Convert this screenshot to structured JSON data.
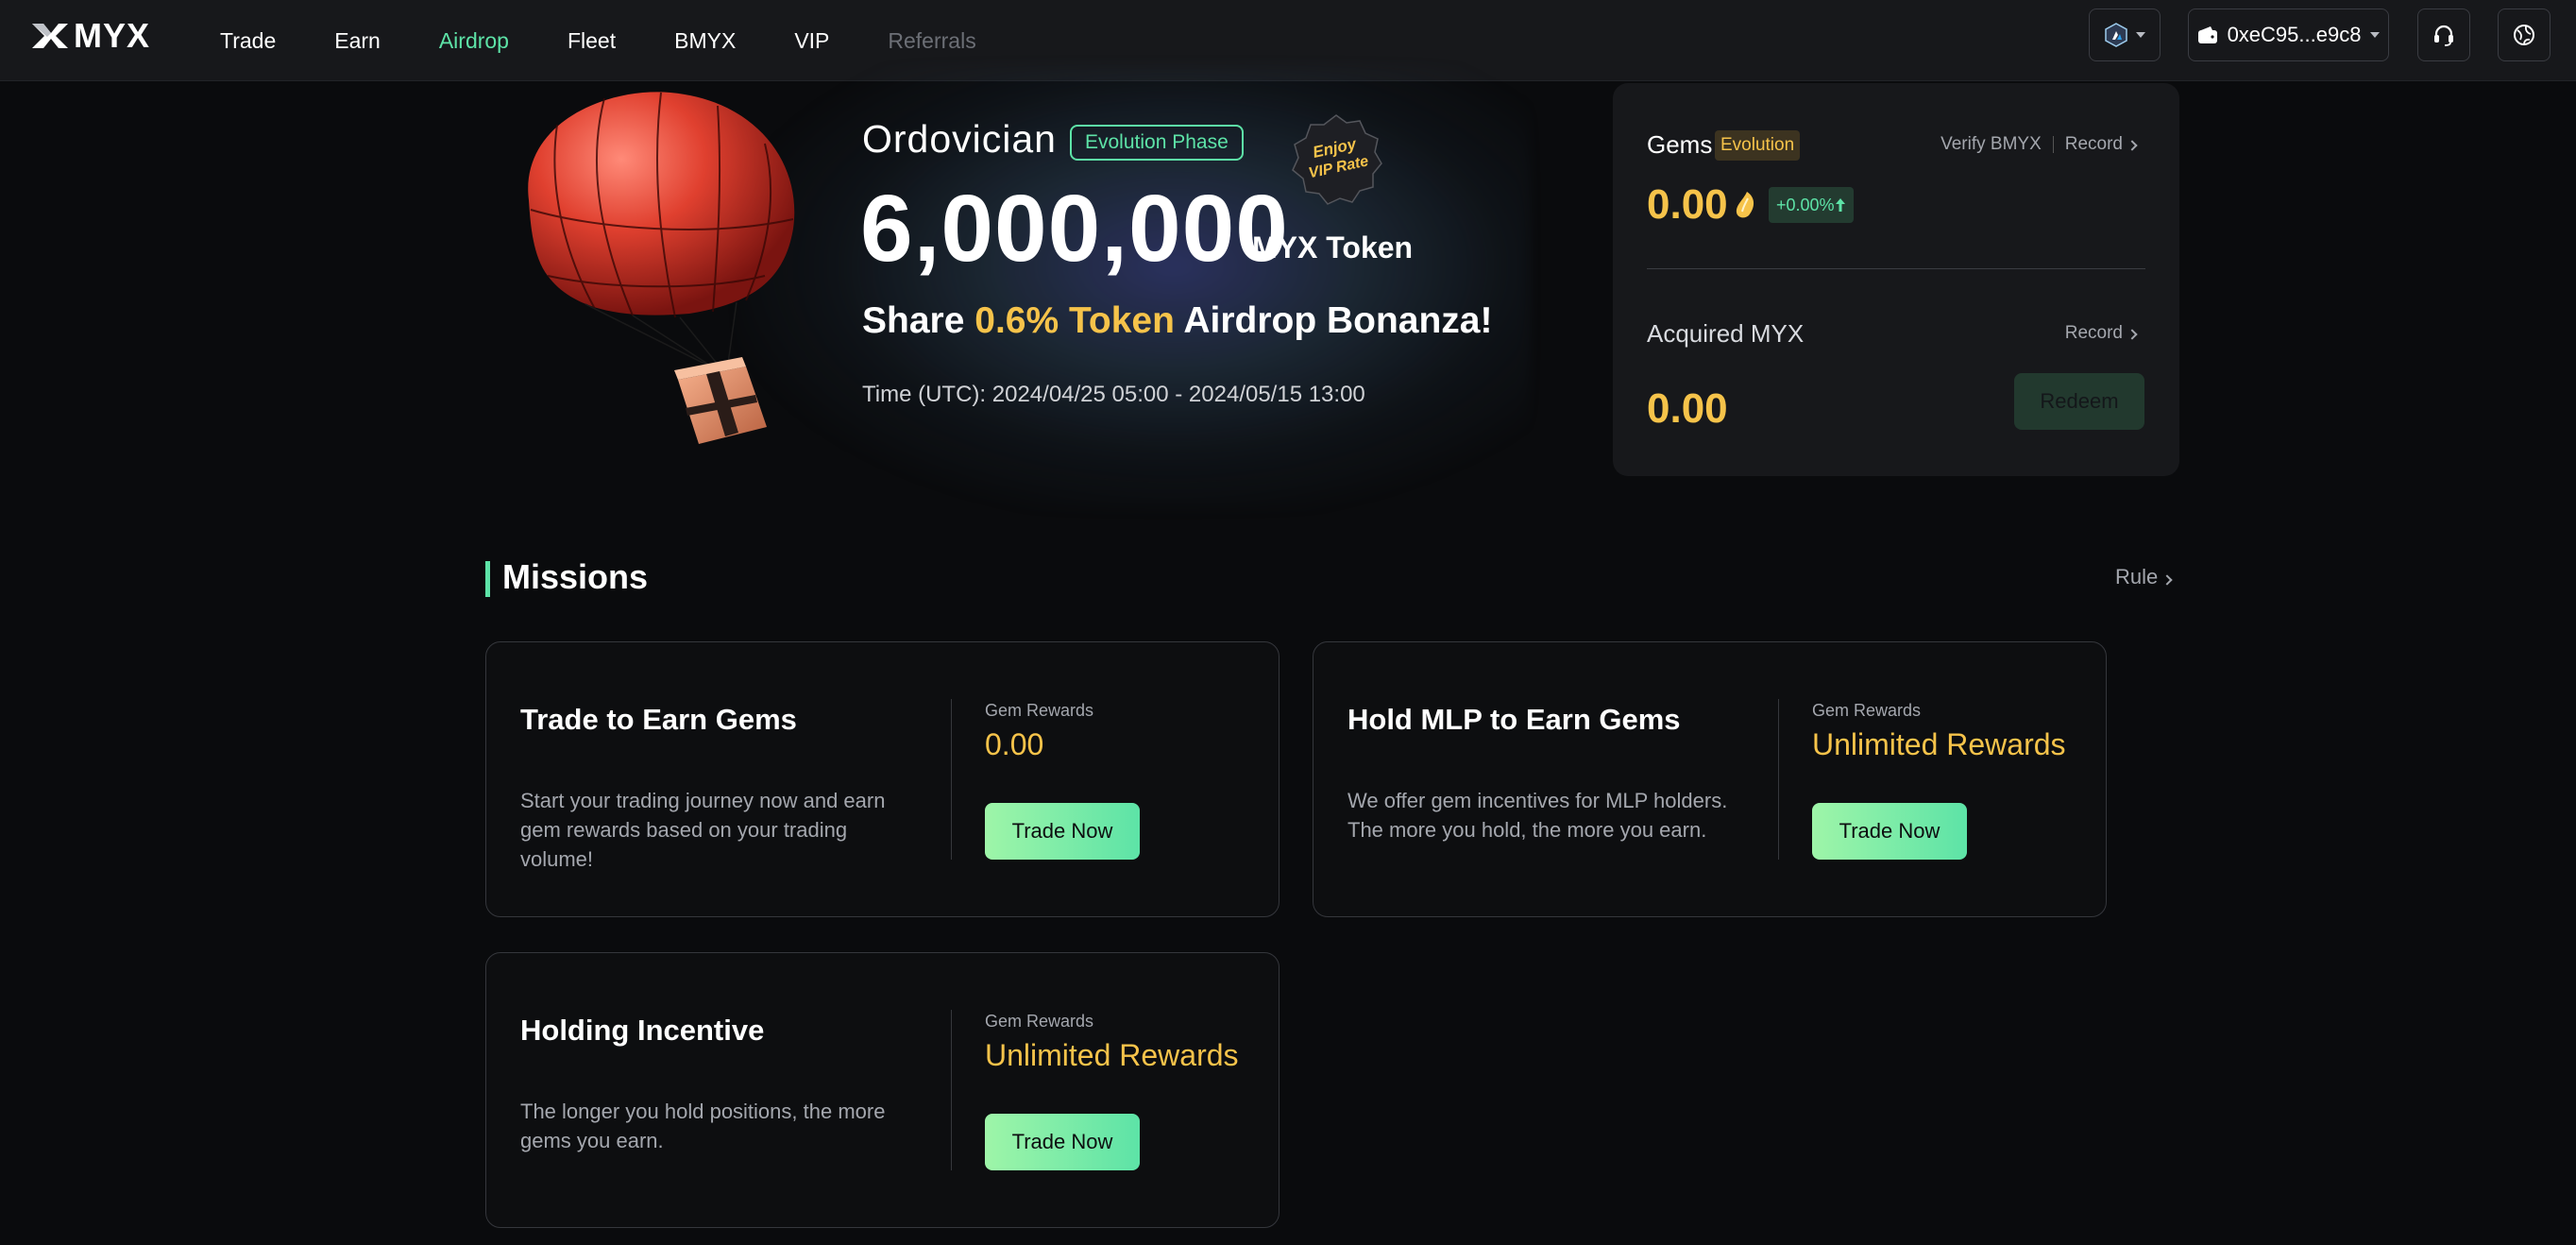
{
  "nav": {
    "logo_text": "MYX",
    "links": [
      {
        "label": "Trade",
        "state": "normal"
      },
      {
        "label": "Earn",
        "state": "normal"
      },
      {
        "label": "Airdrop",
        "state": "active"
      },
      {
        "label": "Fleet",
        "state": "normal"
      },
      {
        "label": "BMYX",
        "state": "normal"
      },
      {
        "label": "VIP",
        "state": "normal"
      },
      {
        "label": "Referrals",
        "state": "disabled"
      }
    ],
    "wallet_address": "0xeC95...e9c8",
    "chain_icon": "arbitrum-icon",
    "support_icon": "headset-icon",
    "language_icon": "globe-icon"
  },
  "hero": {
    "phase_name": "Ordovician",
    "phase_badge": "Evolution Phase",
    "vip_seal_line1": "Enjoy",
    "vip_seal_line2": "VIP Rate",
    "amount": "6,000,000",
    "token_label": "MYX Token",
    "share_prefix": "Share",
    "share_highlight": "0.6% Token",
    "share_suffix": "Airdrop Bonanza!",
    "time_text": "Time (UTC): 2024/04/25 05:00 - 2024/05/15 13:00"
  },
  "gems_card": {
    "gems_title": "Gems",
    "gems_badge": "Evolution",
    "verify_link": "Verify BMYX",
    "record_link": "Record",
    "gems_value": "0.00",
    "gems_change": "+0.00%",
    "acquired_title": "Acquired MYX",
    "acquired_record": "Record",
    "acquired_value": "0.00",
    "redeem_label": "Redeem"
  },
  "missions": {
    "title": "Missions",
    "rule_link": "Rule",
    "cards": [
      {
        "title": "Trade to Earn Gems",
        "description": "Start your trading journey now and earn gem rewards based on your trading volume!",
        "reward_label": "Gem Rewards",
        "reward_value": "0.00",
        "button": "Trade Now"
      },
      {
        "title": "Hold MLP to Earn Gems",
        "description": "We offer gem incentives for MLP holders. The more you hold, the more you earn.",
        "reward_label": "Gem Rewards",
        "reward_value": "Unlimited Rewards",
        "button": "Trade Now"
      },
      {
        "title": "Holding Incentive",
        "description": "The longer you hold positions, the more gems you earn.",
        "reward_label": "Gem Rewards",
        "reward_value": "Unlimited Rewards",
        "button": "Trade Now"
      }
    ]
  },
  "colors": {
    "accent_green": "#5de3a7",
    "gold": "#f6c34a",
    "nav_bg": "#17181b",
    "page_bg": "#0a0b0d"
  }
}
